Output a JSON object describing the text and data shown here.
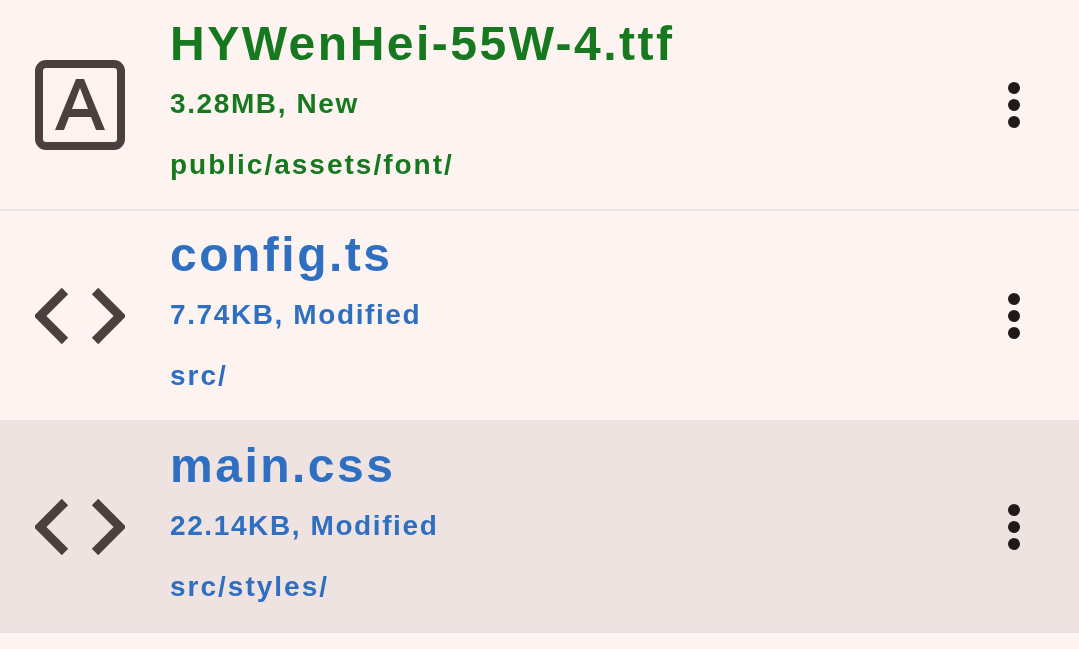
{
  "files": [
    {
      "name": "HYWenHei-55W-4.ttf",
      "details": "3.28MB, New",
      "path": "public/assets/font/",
      "kind": "font",
      "color": "#17791f",
      "selected": false
    },
    {
      "name": "config.ts",
      "details": "7.74KB, Modified",
      "path": "src/",
      "kind": "code",
      "color": "#2e6fc2",
      "selected": false
    },
    {
      "name": "main.css",
      "details": "22.14KB, Modified",
      "path": "src/styles/",
      "kind": "code",
      "color": "#2e6fc2",
      "selected": true
    }
  ]
}
